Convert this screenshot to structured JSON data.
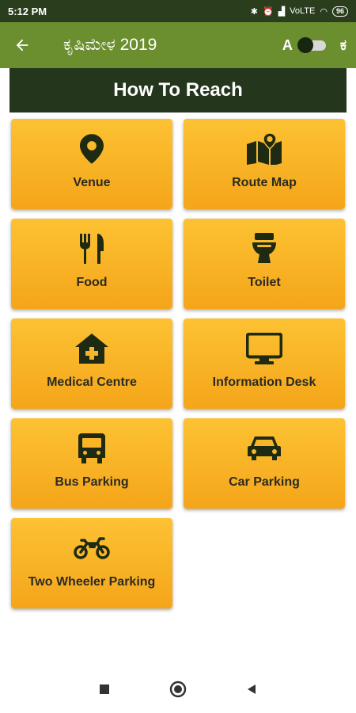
{
  "status": {
    "time": "5:12 PM",
    "network": "VoLTE",
    "battery": "96"
  },
  "app_bar": {
    "title": "ಕೃಷಿಮೇಳ 2019",
    "lang_left": "A",
    "lang_right": "ಕ"
  },
  "header": {
    "title": "How To Reach"
  },
  "tiles": [
    {
      "label": "Venue",
      "icon": "location-pin-icon"
    },
    {
      "label": "Route Map",
      "icon": "map-icon"
    },
    {
      "label": "Food",
      "icon": "fork-knife-icon"
    },
    {
      "label": "Toilet",
      "icon": "toilet-icon"
    },
    {
      "label": "Medical Centre",
      "icon": "hospital-icon"
    },
    {
      "label": "Information Desk",
      "icon": "monitor-icon"
    },
    {
      "label": "Bus Parking",
      "icon": "bus-icon"
    },
    {
      "label": "Car Parking",
      "icon": "car-icon"
    },
    {
      "label": "Two Wheeler Parking",
      "icon": "motorcycle-icon"
    }
  ],
  "colors": {
    "app_bar": "#6b8e2e",
    "header": "#24371c",
    "tile": "#f9b528",
    "icon": "#1e2a12"
  }
}
